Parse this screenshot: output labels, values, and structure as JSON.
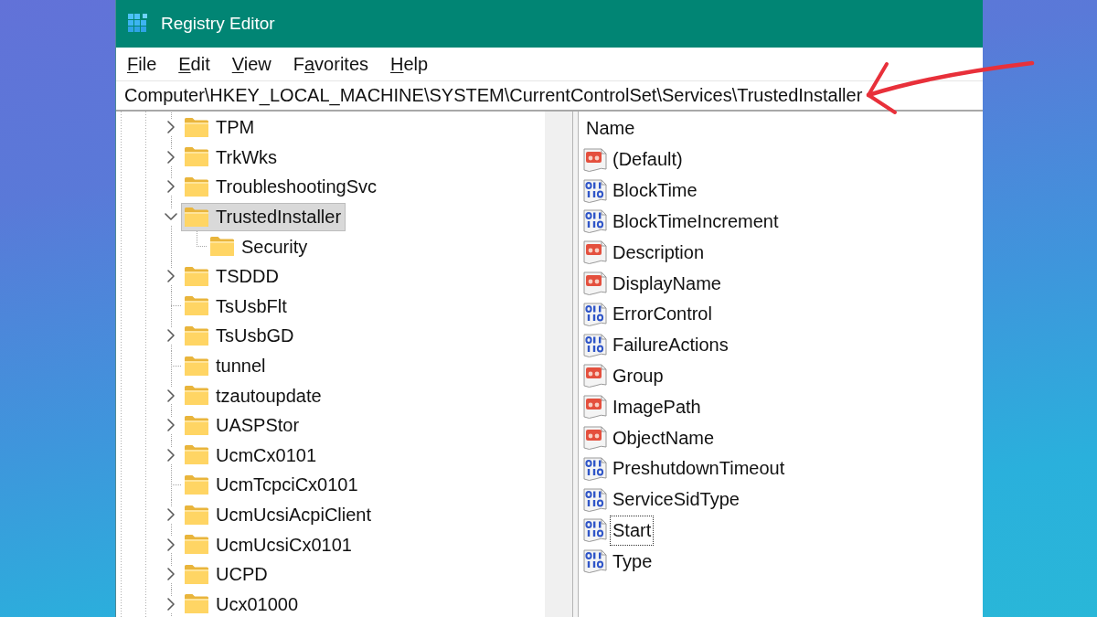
{
  "window": {
    "title": "Registry Editor"
  },
  "menu_bar": [
    {
      "label": "File",
      "letter_underlined": [
        true,
        false,
        false,
        false
      ]
    },
    {
      "label": "Edit",
      "letter_underlined": [
        true,
        false,
        false,
        false
      ]
    },
    {
      "label": "View",
      "letter_underlined": [
        true,
        false,
        false,
        false
      ]
    },
    {
      "label": "Favorites",
      "letter_underlined": [
        false,
        true,
        false,
        false,
        false,
        false,
        false,
        false,
        false
      ]
    },
    {
      "label": "Help",
      "letter_underlined": [
        true,
        false,
        false,
        false
      ]
    }
  ],
  "address_bar": {
    "value": "Computer\\HKEY_LOCAL_MACHINE\\SYSTEM\\CurrentControlSet\\Services\\TrustedInstaller"
  },
  "tree": {
    "items": [
      {
        "label": "TPM",
        "kind": "branch",
        "expanded": false,
        "selected": false
      },
      {
        "label": "TrkWks",
        "kind": "branch",
        "expanded": false,
        "selected": false
      },
      {
        "label": "TroubleshootingSvc",
        "kind": "branch",
        "expanded": false,
        "selected": false
      },
      {
        "label": "TrustedInstaller",
        "kind": "branch",
        "expanded": true,
        "selected": true,
        "children": [
          {
            "label": "Security",
            "kind": "leaf",
            "expanded": false,
            "selected": false
          }
        ]
      },
      {
        "label": "TSDDD",
        "kind": "branch",
        "expanded": false,
        "selected": false
      },
      {
        "label": "TsUsbFlt",
        "kind": "leaf",
        "expanded": false,
        "selected": false
      },
      {
        "label": "TsUsbGD",
        "kind": "branch",
        "expanded": false,
        "selected": false
      },
      {
        "label": "tunnel",
        "kind": "leaf",
        "expanded": false,
        "selected": false
      },
      {
        "label": "tzautoupdate",
        "kind": "branch",
        "expanded": false,
        "selected": false
      },
      {
        "label": "UASPStor",
        "kind": "branch",
        "expanded": false,
        "selected": false
      },
      {
        "label": "UcmCx0101",
        "kind": "branch",
        "expanded": false,
        "selected": false
      },
      {
        "label": "UcmTcpciCx0101",
        "kind": "leaf",
        "expanded": false,
        "selected": false
      },
      {
        "label": "UcmUcsiAcpiClient",
        "kind": "branch",
        "expanded": false,
        "selected": false
      },
      {
        "label": "UcmUcsiCx0101",
        "kind": "branch",
        "expanded": false,
        "selected": false
      },
      {
        "label": "UCPD",
        "kind": "branch",
        "expanded": false,
        "selected": false
      },
      {
        "label": "Ucx01000",
        "kind": "branch",
        "expanded": false,
        "selected": false
      }
    ]
  },
  "values": {
    "columns": [
      "Name"
    ],
    "rows": [
      {
        "name": "(Default)",
        "kind": "string",
        "focused": false
      },
      {
        "name": "BlockTime",
        "kind": "binary",
        "focused": false
      },
      {
        "name": "BlockTimeIncrement",
        "kind": "binary",
        "focused": false
      },
      {
        "name": "Description",
        "kind": "string",
        "focused": false
      },
      {
        "name": "DisplayName",
        "kind": "string",
        "focused": false
      },
      {
        "name": "ErrorControl",
        "kind": "binary",
        "focused": false
      },
      {
        "name": "FailureActions",
        "kind": "binary",
        "focused": false
      },
      {
        "name": "Group",
        "kind": "string",
        "focused": false
      },
      {
        "name": "ImagePath",
        "kind": "string",
        "focused": false
      },
      {
        "name": "ObjectName",
        "kind": "string",
        "focused": false
      },
      {
        "name": "PreshutdownTimeout",
        "kind": "binary",
        "focused": false
      },
      {
        "name": "ServiceSidType",
        "kind": "binary",
        "focused": false
      },
      {
        "name": "Start",
        "kind": "binary",
        "focused": true
      },
      {
        "name": "Type",
        "kind": "binary",
        "focused": false
      }
    ]
  }
}
